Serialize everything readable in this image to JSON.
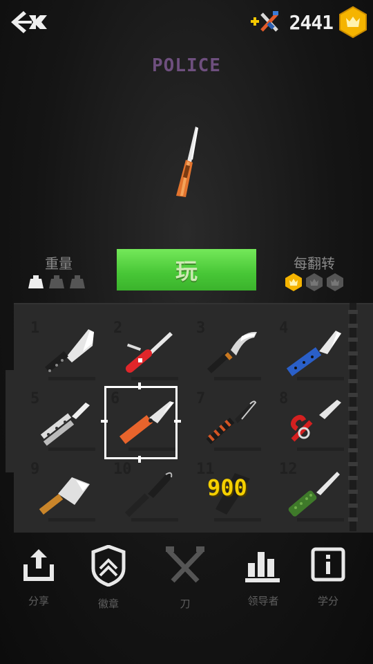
{
  "coins": {
    "count": "2441"
  },
  "knife": {
    "name": "POLICE"
  },
  "stats": {
    "weight_label": "重量",
    "flip_label": "每翻转"
  },
  "play": {
    "label": "玩"
  },
  "slots": [
    {
      "number": "1"
    },
    {
      "number": "2"
    },
    {
      "number": "3"
    },
    {
      "number": "4"
    },
    {
      "number": "5"
    },
    {
      "number": "6"
    },
    {
      "number": "7"
    },
    {
      "number": "8"
    },
    {
      "number": "9"
    },
    {
      "number": "10"
    },
    {
      "number": "11",
      "price": "900"
    },
    {
      "number": "12"
    }
  ],
  "nav": [
    {
      "label": "分享",
      "icon": "share-icon"
    },
    {
      "label": "徽章",
      "icon": "badge-icon"
    },
    {
      "label": "刀",
      "icon": "crossed-knives-icon"
    },
    {
      "label": "领导者",
      "icon": "leaderboard-icon"
    },
    {
      "label": "学分",
      "icon": "info-icon"
    }
  ],
  "colors": {
    "play_green": "#47c636",
    "coin_gold": "#f5b400",
    "price_yellow": "#f5d000",
    "name_purple": "#6e4f7e"
  }
}
